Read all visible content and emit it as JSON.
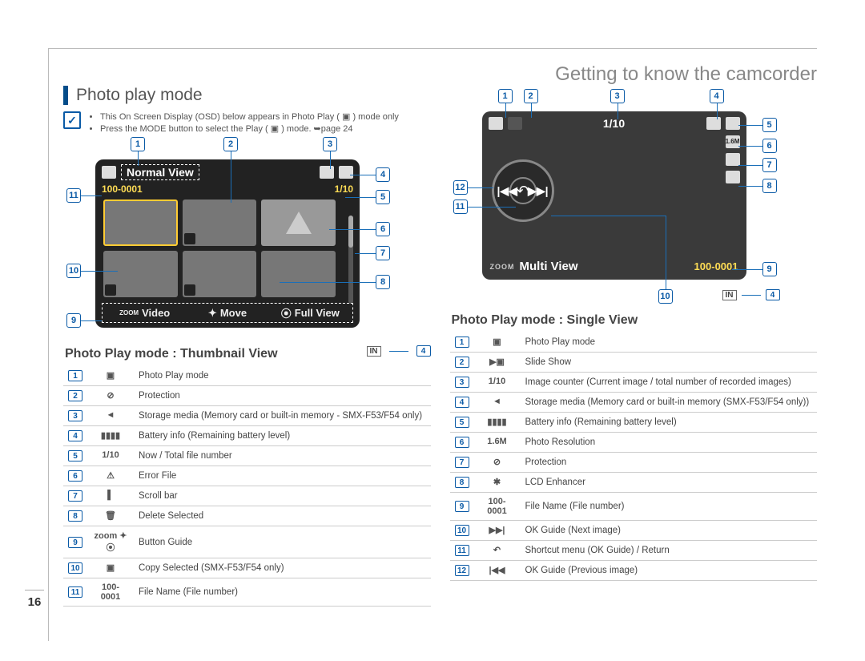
{
  "chapter_title": "Getting to know the camcorder",
  "section_title": "Photo play mode",
  "page_number": "16",
  "notes": [
    "This On Screen Display (OSD) below appears in Photo Play ( ▣ ) mode only",
    "Press the MODE button to select the Play ( ▣ ) mode. ➥page 24"
  ],
  "thumbnail_screen": {
    "title": "Normal View",
    "file_name": "100-0001",
    "counter": "1/10",
    "bottom": {
      "left": "Video",
      "mid": "Move",
      "right": "Full View",
      "zoom": "ZOOM"
    }
  },
  "single_screen": {
    "counter": "1/10",
    "multi_view": "Multi View",
    "zoom": "ZOOM",
    "file_name": "100-0001"
  },
  "thumbnail_caption": "Photo Play mode : Thumbnail View",
  "single_caption": "Photo Play mode : Single View",
  "in_label": "IN",
  "thumbnail_legend": [
    {
      "n": "1",
      "sym": "▣",
      "desc": "Photo Play mode"
    },
    {
      "n": "2",
      "sym": "⊘",
      "desc": "Protection"
    },
    {
      "n": "3",
      "sym": "◄",
      "desc": "Storage media (Memory card or built-in memory - SMX-F53/F54 only)"
    },
    {
      "n": "4",
      "sym": "▮▮▮▮",
      "desc": "Battery info (Remaining battery level)"
    },
    {
      "n": "5",
      "sym": "1/10",
      "desc": "Now / Total file number"
    },
    {
      "n": "6",
      "sym": "⚠",
      "desc": "Error File"
    },
    {
      "n": "7",
      "sym": "▌",
      "desc": "Scroll bar"
    },
    {
      "n": "8",
      "sym": "🗑",
      "desc": "Delete Selected"
    },
    {
      "n": "9",
      "sym": "zoom ✦ ⦿",
      "desc": "Button Guide"
    },
    {
      "n": "10",
      "sym": "▣",
      "desc": "Copy Selected (SMX-F53/F54 only)"
    },
    {
      "n": "11",
      "sym": "100-0001",
      "desc": "File Name (File number)"
    }
  ],
  "single_legend": [
    {
      "n": "1",
      "sym": "▣",
      "desc": "Photo Play mode"
    },
    {
      "n": "2",
      "sym": "▶▣",
      "desc": "Slide Show"
    },
    {
      "n": "3",
      "sym": "1/10",
      "desc": "Image counter (Current image / total number of recorded images)"
    },
    {
      "n": "4",
      "sym": "◄",
      "desc": "Storage media (Memory card or built-in memory (SMX-F53/F54 only))"
    },
    {
      "n": "5",
      "sym": "▮▮▮▮",
      "desc": "Battery info (Remaining battery level)"
    },
    {
      "n": "6",
      "sym": "1.6M",
      "desc": "Photo Resolution"
    },
    {
      "n": "7",
      "sym": "⊘",
      "desc": "Protection"
    },
    {
      "n": "8",
      "sym": "✱",
      "desc": "LCD Enhancer"
    },
    {
      "n": "9",
      "sym": "100-0001",
      "desc": "File Name (File number)"
    },
    {
      "n": "10",
      "sym": "▶▶|",
      "desc": "OK Guide (Next image)"
    },
    {
      "n": "11",
      "sym": "↶",
      "desc": "Shortcut menu (OK Guide) / Return"
    },
    {
      "n": "12",
      "sym": "|◀◀",
      "desc": "OK Guide (Previous image)"
    }
  ]
}
